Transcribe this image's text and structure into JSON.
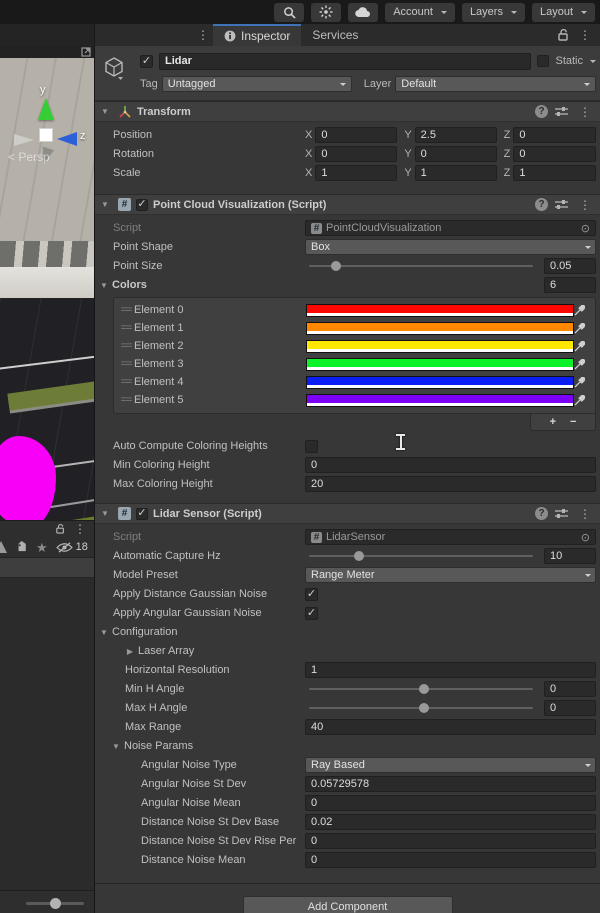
{
  "toolbar": {
    "account": "Account",
    "layers": "Layers",
    "layout": "Layout"
  },
  "tabs": {
    "inspector": "Inspector",
    "services": "Services"
  },
  "gameobject": {
    "name": "Lidar",
    "static_label": "Static",
    "tag_label": "Tag",
    "tag_value": "Untagged",
    "layer_label": "Layer",
    "layer_value": "Default"
  },
  "transform": {
    "title": "Transform",
    "axes": [
      "X",
      "Y",
      "Z"
    ],
    "rows": [
      {
        "label": "Position",
        "values": [
          "0",
          "2.5",
          "0"
        ]
      },
      {
        "label": "Rotation",
        "values": [
          "0",
          "0",
          "0"
        ]
      },
      {
        "label": "Scale",
        "values": [
          "1",
          "1",
          "1"
        ]
      }
    ]
  },
  "pcv": {
    "title": "Point Cloud Visualization (Script)",
    "script_label": "Script",
    "script_value": "PointCloudVisualization",
    "shape_label": "Point Shape",
    "shape_value": "Box",
    "size_label": "Point Size",
    "size_value": "0.05",
    "colors_label": "Colors",
    "colors_count": "6",
    "elements": [
      {
        "label": "Element 0",
        "color": "#ff0600"
      },
      {
        "label": "Element 1",
        "color": "#ff8800"
      },
      {
        "label": "Element 2",
        "color": "#ffe800"
      },
      {
        "label": "Element 3",
        "color": "#0cf228"
      },
      {
        "label": "Element 4",
        "color": "#0b1ef4"
      },
      {
        "label": "Element 5",
        "color": "#7c00f5"
      }
    ],
    "add_label": "+",
    "remove_label": "−",
    "auto_label": "Auto Compute Coloring Heights",
    "min_label": "Min Coloring Height",
    "min_value": "0",
    "max_label": "Max Coloring Height",
    "max_value": "20"
  },
  "lidar": {
    "title": "Lidar Sensor (Script)",
    "script_label": "Script",
    "script_value": "LidarSensor",
    "hz_label": "Automatic Capture Hz",
    "hz_value": "10",
    "preset_label": "Model Preset",
    "preset_value": "Range Meter",
    "dist_noise_label": "Apply Distance Gaussian Noise",
    "ang_noise_label": "Apply Angular Gaussian Noise",
    "config_label": "Configuration",
    "laser_label": "Laser Array",
    "hres_label": "Horizontal Resolution",
    "hres_value": "1",
    "minh_label": "Min H Angle",
    "minh_value": "0",
    "maxh_label": "Max H Angle",
    "maxh_value": "0",
    "range_label": "Max Range",
    "range_value": "40",
    "noise_label": "Noise Params",
    "noise_rows": [
      {
        "label": "Angular Noise Type",
        "value": "Ray Based"
      },
      {
        "label": "Angular Noise St Dev",
        "value": "0.05729578"
      },
      {
        "label": "Angular Noise Mean",
        "value": "0"
      },
      {
        "label": "Distance Noise St Dev Base",
        "value": "0.02"
      },
      {
        "label": "Distance Noise St Dev Rise Per",
        "value": "0"
      },
      {
        "label": "Distance Noise Mean",
        "value": "0"
      }
    ]
  },
  "add_component_label": "Add Component",
  "scene": {
    "axis_y": "y",
    "axis_z": "z",
    "persp_prefix": "<",
    "persp_label": "Persp",
    "hidden_count": "18"
  },
  "colors": {
    "accent_blue": "#3d74b8",
    "pointcloud_magenta": "#f800f8"
  }
}
